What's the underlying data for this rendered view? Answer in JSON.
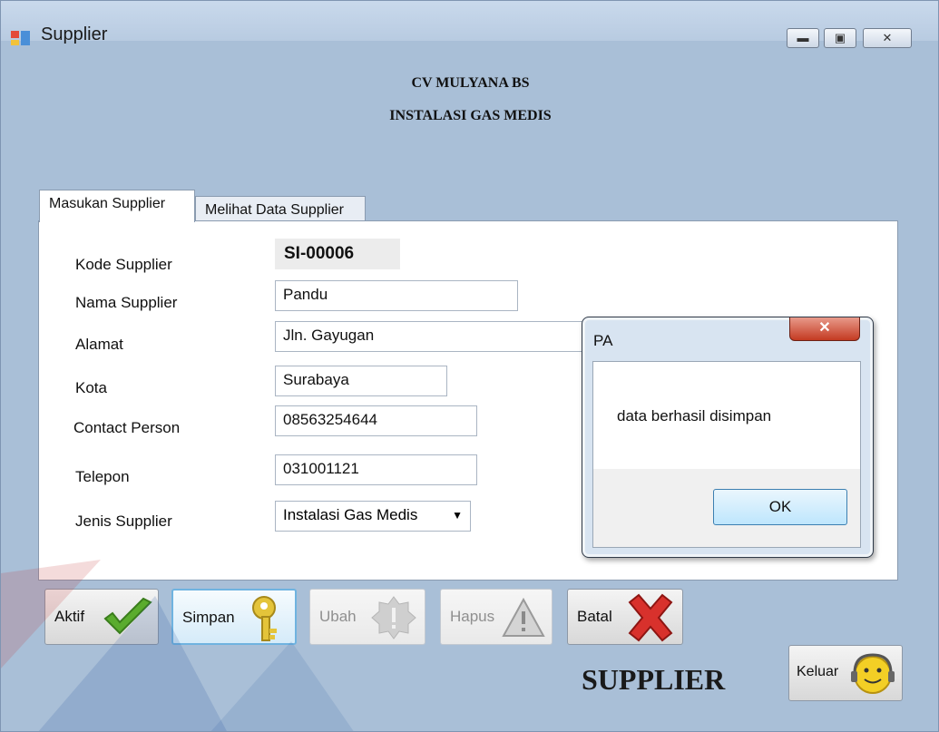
{
  "window": {
    "title": "Supplier"
  },
  "header": {
    "company": "CV MULYANA BS",
    "subtitle": "INSTALASI GAS MEDIS"
  },
  "tabs": [
    {
      "label": "Masukan Supplier",
      "active": true
    },
    {
      "label": "Melihat Data Supplier",
      "active": false
    }
  ],
  "form": {
    "kode_label": "Kode Supplier",
    "kode_value": "SI-00006",
    "nama_label": "Nama Supplier",
    "nama_value": "Pandu",
    "alamat_label": "Alamat",
    "alamat_value": "Jln. Gayugan",
    "kota_label": "Kota",
    "kota_value": "Surabaya",
    "contact_label": "Contact Person",
    "contact_value": "08563254644",
    "telepon_label": "Telepon",
    "telepon_value": "031001121",
    "jenis_label": "Jenis Supplier",
    "jenis_value": "Instalasi Gas Medis"
  },
  "dialog": {
    "title": "PA",
    "message": "data berhasil disimpan",
    "ok_label": "OK"
  },
  "toolbar": {
    "aktif": "Aktif",
    "simpan": "Simpan",
    "ubah": "Ubah",
    "hapus": "Hapus",
    "batal": "Batal"
  },
  "footer": {
    "title": "SUPPLIER",
    "keluar": "Keluar"
  },
  "colors": {
    "window_bg": "#a9bfd7",
    "check": "#5aac2e",
    "cross": "#d8312c",
    "key": "#e4c43a",
    "dialog_close": "#c43a22"
  }
}
